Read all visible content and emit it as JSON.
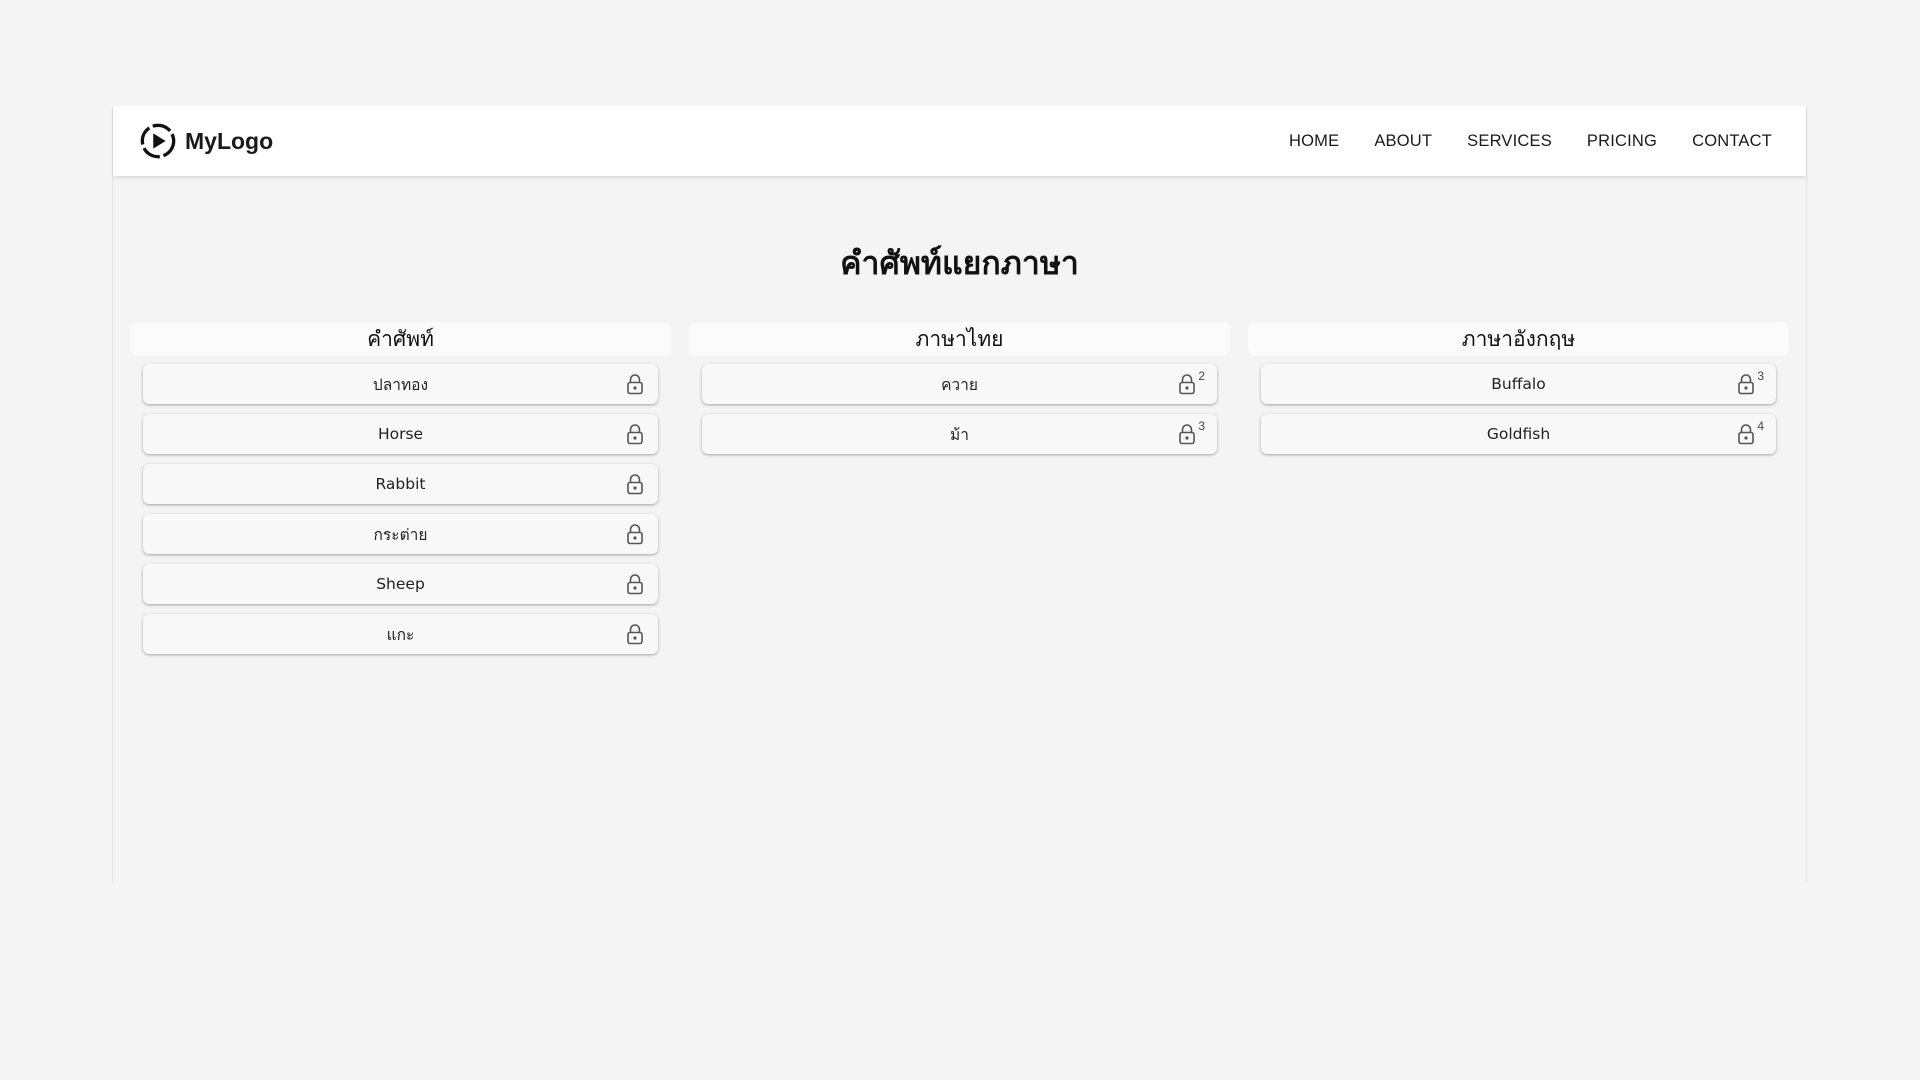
{
  "header": {
    "brand": "MyLogo",
    "nav": [
      "HOME",
      "ABOUT",
      "SERVICES",
      "PRICING",
      "CONTACT"
    ]
  },
  "main": {
    "title": "คำศัพท์แยกภาษา",
    "columns": [
      {
        "header": "คำศัพท์",
        "items": [
          {
            "label": "ปลาทอง",
            "count": ""
          },
          {
            "label": "Horse",
            "count": ""
          },
          {
            "label": "Rabbit",
            "count": ""
          },
          {
            "label": "กระต่าย",
            "count": ""
          },
          {
            "label": "Sheep",
            "count": ""
          },
          {
            "label": "แกะ",
            "count": ""
          }
        ]
      },
      {
        "header": "ภาษาไทย",
        "items": [
          {
            "label": "ควาย",
            "count": "2"
          },
          {
            "label": "ม้า",
            "count": "3"
          }
        ]
      },
      {
        "header": "ภาษาอังกฤษ",
        "items": [
          {
            "label": "Buffalo",
            "count": "3"
          },
          {
            "label": "Goldfish",
            "count": "4"
          }
        ]
      }
    ]
  },
  "icons": {
    "logo": "play-circle-icon",
    "item_action": "lock-icon"
  },
  "colors": {
    "background": "#f4f4f4",
    "navbar": "#ffffff",
    "text": "#1a1a1a",
    "icon": "#555555"
  }
}
